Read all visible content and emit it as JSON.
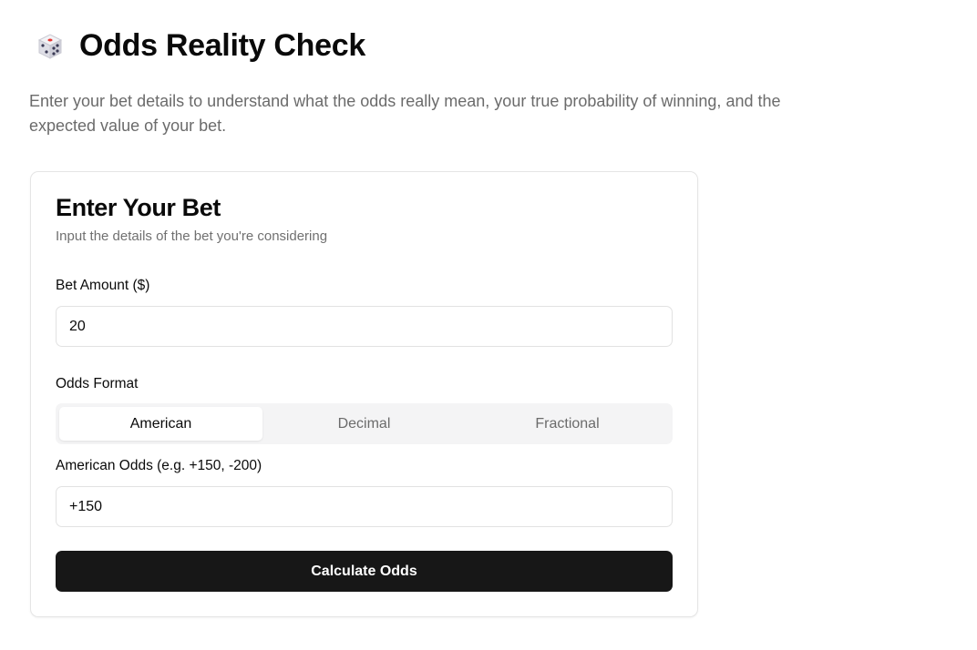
{
  "header": {
    "icon": "dice-icon",
    "title": "Odds Reality Check"
  },
  "intro": "Enter your bet details to understand what the odds really mean, your true probability of winning, and the expected value of your bet.",
  "card": {
    "title": "Enter Your Bet",
    "description": "Input the details of the bet you're considering",
    "bet_amount": {
      "label": "Bet Amount ($)",
      "value": "20"
    },
    "odds_format": {
      "label": "Odds Format",
      "tabs": [
        "American",
        "Decimal",
        "Fractional"
      ],
      "selected": "American"
    },
    "odds_input": {
      "label": "American Odds (e.g. +150, -200)",
      "value": "+150"
    },
    "submit_label": "Calculate Odds"
  },
  "colors": {
    "primary_button": "#171717",
    "muted_text": "#6b6b6b",
    "tab_track": "#f4f4f5"
  }
}
